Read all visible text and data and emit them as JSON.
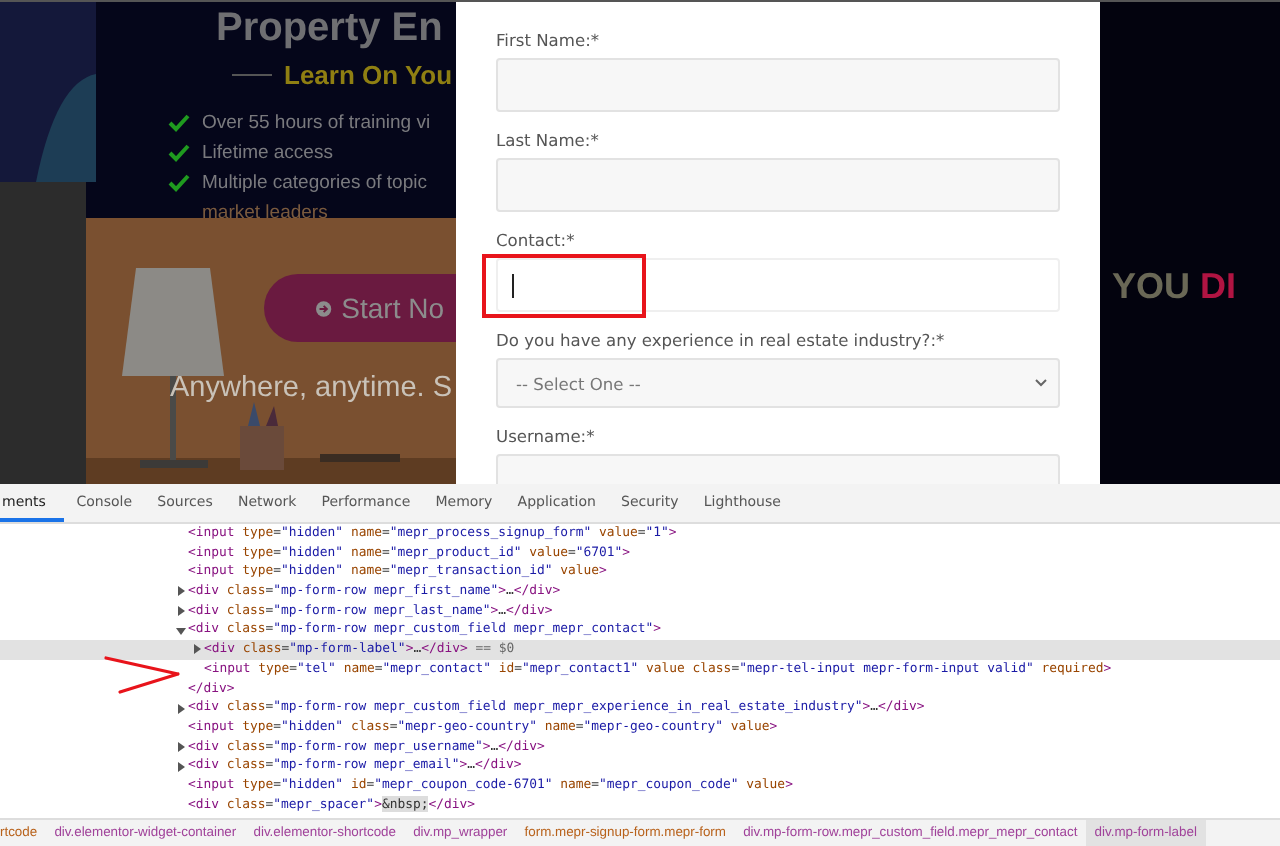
{
  "hero": {
    "title": "Property En",
    "subtitle": "Learn On You",
    "features": [
      {
        "kind": "check",
        "text": "Over 55 hours of training vi"
      },
      {
        "kind": "check",
        "text": "Lifetime access"
      },
      {
        "kind": "check",
        "text": "Multiple categories of topic"
      },
      {
        "kind": "continuation",
        "text": "market leaders"
      }
    ],
    "button": "Start No",
    "tagline": "Anywhere, anytime. S"
  },
  "signup_form": {
    "fields": [
      {
        "kind": "text",
        "label": "First Name:*",
        "focused": false
      },
      {
        "kind": "text",
        "label": "Last Name:*",
        "focused": false
      },
      {
        "kind": "text",
        "label": "Contact:*",
        "focused": true
      },
      {
        "kind": "select",
        "label": "Do you have any experience in real estate industry?:*",
        "value": "-- Select One --"
      },
      {
        "kind": "text",
        "label": "Username:*",
        "focused": false
      }
    ]
  },
  "side_heading": {
    "lead": "YOU",
    "accent": "DI"
  },
  "devtools": {
    "tabs": [
      {
        "label": "ments",
        "selected": true
      },
      {
        "label": "Console",
        "selected": false
      },
      {
        "label": "Sources",
        "selected": false
      },
      {
        "label": "Network",
        "selected": false
      },
      {
        "label": "Performance",
        "selected": false
      },
      {
        "label": "Memory",
        "selected": false
      },
      {
        "label": "Application",
        "selected": false
      },
      {
        "label": "Security",
        "selected": false
      },
      {
        "label": "Lighthouse",
        "selected": false
      }
    ],
    "nodes": [
      {
        "kind": "leaf",
        "selected": false,
        "tokens": [
          {
            "kind": "tag",
            "text": "<input"
          },
          {
            "kind": "attr",
            "text": " type"
          },
          {
            "kind": "plain",
            "text": "="
          },
          {
            "kind": "value",
            "text": "\"hidden\""
          },
          {
            "kind": "attr",
            "text": " name"
          },
          {
            "kind": "plain",
            "text": "="
          },
          {
            "kind": "value",
            "text": "\"mepr_process_signup_form\""
          },
          {
            "kind": "attr",
            "text": " value"
          },
          {
            "kind": "plain",
            "text": "="
          },
          {
            "kind": "value",
            "text": "\"1\""
          },
          {
            "kind": "tag",
            "text": ">"
          }
        ]
      },
      {
        "kind": "leaf",
        "selected": false,
        "tokens": [
          {
            "kind": "tag",
            "text": "<input"
          },
          {
            "kind": "attr",
            "text": " type"
          },
          {
            "kind": "plain",
            "text": "="
          },
          {
            "kind": "value",
            "text": "\"hidden\""
          },
          {
            "kind": "attr",
            "text": " name"
          },
          {
            "kind": "plain",
            "text": "="
          },
          {
            "kind": "value",
            "text": "\"mepr_product_id\""
          },
          {
            "kind": "attr",
            "text": " value"
          },
          {
            "kind": "plain",
            "text": "="
          },
          {
            "kind": "value",
            "text": "\"6701\""
          },
          {
            "kind": "tag",
            "text": ">"
          }
        ]
      },
      {
        "kind": "leaf",
        "selected": false,
        "tokens": [
          {
            "kind": "tag",
            "text": "<input"
          },
          {
            "kind": "attr",
            "text": " type"
          },
          {
            "kind": "plain",
            "text": "="
          },
          {
            "kind": "value",
            "text": "\"hidden\""
          },
          {
            "kind": "attr",
            "text": " name"
          },
          {
            "kind": "plain",
            "text": "="
          },
          {
            "kind": "value",
            "text": "\"mepr_transaction_id\""
          },
          {
            "kind": "attr",
            "text": " value"
          },
          {
            "kind": "tag",
            "text": ">"
          }
        ]
      },
      {
        "kind": "container",
        "expanded": false,
        "selected": false,
        "tokens": [
          {
            "kind": "tag",
            "text": "<div"
          },
          {
            "kind": "attr",
            "text": " class"
          },
          {
            "kind": "plain",
            "text": "="
          },
          {
            "kind": "value",
            "text": "\"mp-form-row mepr_first_name\""
          },
          {
            "kind": "tag",
            "text": ">"
          },
          {
            "kind": "plain",
            "text": "…"
          },
          {
            "kind": "tag",
            "text": "</div>"
          }
        ]
      },
      {
        "kind": "container",
        "expanded": false,
        "selected": false,
        "tokens": [
          {
            "kind": "tag",
            "text": "<div"
          },
          {
            "kind": "attr",
            "text": " class"
          },
          {
            "kind": "plain",
            "text": "="
          },
          {
            "kind": "value",
            "text": "\"mp-form-row mepr_last_name\""
          },
          {
            "kind": "tag",
            "text": ">"
          },
          {
            "kind": "plain",
            "text": "…"
          },
          {
            "kind": "tag",
            "text": "</div>"
          }
        ]
      },
      {
        "kind": "container",
        "expanded": true,
        "selected": false,
        "tokens": [
          {
            "kind": "tag",
            "text": "<div"
          },
          {
            "kind": "attr",
            "text": " class"
          },
          {
            "kind": "plain",
            "text": "="
          },
          {
            "kind": "value",
            "text": "\"mp-form-row mepr_custom_field mepr_mepr_contact\""
          },
          {
            "kind": "tag",
            "text": ">"
          }
        ],
        "children": [
          {
            "kind": "container",
            "expanded": false,
            "selected": true,
            "tokens": [
              {
                "kind": "tag",
                "text": "<div"
              },
              {
                "kind": "attr",
                "text": " class"
              },
              {
                "kind": "plain",
                "text": "="
              },
              {
                "kind": "value",
                "text": "\"mp-form-label\""
              },
              {
                "kind": "tag",
                "text": ">"
              },
              {
                "kind": "plain",
                "text": "…"
              },
              {
                "kind": "tag",
                "text": "</div>"
              },
              {
                "kind": "note",
                "text": " == $0"
              }
            ]
          },
          {
            "kind": "leaf",
            "selected": false,
            "tokens": [
              {
                "kind": "tag",
                "text": "<input"
              },
              {
                "kind": "attr",
                "text": " type"
              },
              {
                "kind": "plain",
                "text": "="
              },
              {
                "kind": "value",
                "text": "\"tel\""
              },
              {
                "kind": "attr",
                "text": " name"
              },
              {
                "kind": "plain",
                "text": "="
              },
              {
                "kind": "value",
                "text": "\"mepr_contact\""
              },
              {
                "kind": "attr",
                "text": " id"
              },
              {
                "kind": "plain",
                "text": "="
              },
              {
                "kind": "value",
                "text": "\"mepr_contact1\""
              },
              {
                "kind": "attr",
                "text": " value"
              },
              {
                "kind": "attr",
                "text": " class"
              },
              {
                "kind": "plain",
                "text": "="
              },
              {
                "kind": "value",
                "text": "\"mepr-tel-input mepr-form-input valid\""
              },
              {
                "kind": "attr",
                "text": " required"
              },
              {
                "kind": "tag",
                "text": ">"
              }
            ]
          }
        ],
        "closing": [
          {
            "kind": "tag",
            "text": "</div>"
          }
        ]
      },
      {
        "kind": "container",
        "expanded": false,
        "selected": false,
        "tokens": [
          {
            "kind": "tag",
            "text": "<div"
          },
          {
            "kind": "attr",
            "text": " class"
          },
          {
            "kind": "plain",
            "text": "="
          },
          {
            "kind": "value",
            "text": "\"mp-form-row mepr_custom_field mepr_mepr_experience_in_real_estate_industry\""
          },
          {
            "kind": "tag",
            "text": ">"
          },
          {
            "kind": "plain",
            "text": "…"
          },
          {
            "kind": "tag",
            "text": "</div>"
          }
        ]
      },
      {
        "kind": "leaf",
        "selected": false,
        "tokens": [
          {
            "kind": "tag",
            "text": "<input"
          },
          {
            "kind": "attr",
            "text": " type"
          },
          {
            "kind": "plain",
            "text": "="
          },
          {
            "kind": "value",
            "text": "\"hidden\""
          },
          {
            "kind": "attr",
            "text": " class"
          },
          {
            "kind": "plain",
            "text": "="
          },
          {
            "kind": "value",
            "text": "\"mepr-geo-country\""
          },
          {
            "kind": "attr",
            "text": " name"
          },
          {
            "kind": "plain",
            "text": "="
          },
          {
            "kind": "value",
            "text": "\"mepr-geo-country\""
          },
          {
            "kind": "attr",
            "text": " value"
          },
          {
            "kind": "tag",
            "text": ">"
          }
        ]
      },
      {
        "kind": "container",
        "expanded": false,
        "selected": false,
        "tokens": [
          {
            "kind": "tag",
            "text": "<div"
          },
          {
            "kind": "attr",
            "text": " class"
          },
          {
            "kind": "plain",
            "text": "="
          },
          {
            "kind": "value",
            "text": "\"mp-form-row mepr_username\""
          },
          {
            "kind": "tag",
            "text": ">"
          },
          {
            "kind": "plain",
            "text": "…"
          },
          {
            "kind": "tag",
            "text": "</div>"
          }
        ]
      },
      {
        "kind": "container",
        "expanded": false,
        "selected": false,
        "tokens": [
          {
            "kind": "tag",
            "text": "<div"
          },
          {
            "kind": "attr",
            "text": " class"
          },
          {
            "kind": "plain",
            "text": "="
          },
          {
            "kind": "value",
            "text": "\"mp-form-row mepr_email\""
          },
          {
            "kind": "tag",
            "text": ">"
          },
          {
            "kind": "plain",
            "text": "…"
          },
          {
            "kind": "tag",
            "text": "</div>"
          }
        ]
      },
      {
        "kind": "leaf",
        "selected": false,
        "tokens": [
          {
            "kind": "tag",
            "text": "<input"
          },
          {
            "kind": "attr",
            "text": " type"
          },
          {
            "kind": "plain",
            "text": "="
          },
          {
            "kind": "value",
            "text": "\"hidden\""
          },
          {
            "kind": "attr",
            "text": " id"
          },
          {
            "kind": "plain",
            "text": "="
          },
          {
            "kind": "value",
            "text": "\"mepr_coupon_code-6701\""
          },
          {
            "kind": "attr",
            "text": " name"
          },
          {
            "kind": "plain",
            "text": "="
          },
          {
            "kind": "value",
            "text": "\"mepr_coupon_code\""
          },
          {
            "kind": "attr",
            "text": " value"
          },
          {
            "kind": "tag",
            "text": ">"
          }
        ]
      },
      {
        "kind": "leaf",
        "selected": false,
        "tokens": [
          {
            "kind": "tag",
            "text": "<div"
          },
          {
            "kind": "attr",
            "text": " class"
          },
          {
            "kind": "plain",
            "text": "="
          },
          {
            "kind": "value",
            "text": "\"mepr_spacer\""
          },
          {
            "kind": "tag",
            "text": ">"
          },
          {
            "kind": "entity",
            "text": "&nbsp;"
          },
          {
            "kind": "tag",
            "text": "</div>"
          }
        ]
      }
    ],
    "breadcrumbs": [
      {
        "label": "rtcode",
        "color": "#b8621b",
        "selected": false
      },
      {
        "label": "div.elementor-widget-container",
        "color": "#a0429a",
        "selected": false
      },
      {
        "label": "div.elementor-shortcode",
        "color": "#a0429a",
        "selected": false
      },
      {
        "label": "div.mp_wrapper",
        "color": "#a0429a",
        "selected": false
      },
      {
        "label": "form.mepr-signup-form.mepr-form",
        "color": "#b8621b",
        "selected": false
      },
      {
        "label": "div.mp-form-row.mepr_custom_field.mepr_mepr_contact",
        "color": "#a0429a",
        "selected": false
      },
      {
        "label": "div.mp-form-label",
        "color": "#a0429a",
        "selected": true
      }
    ]
  }
}
